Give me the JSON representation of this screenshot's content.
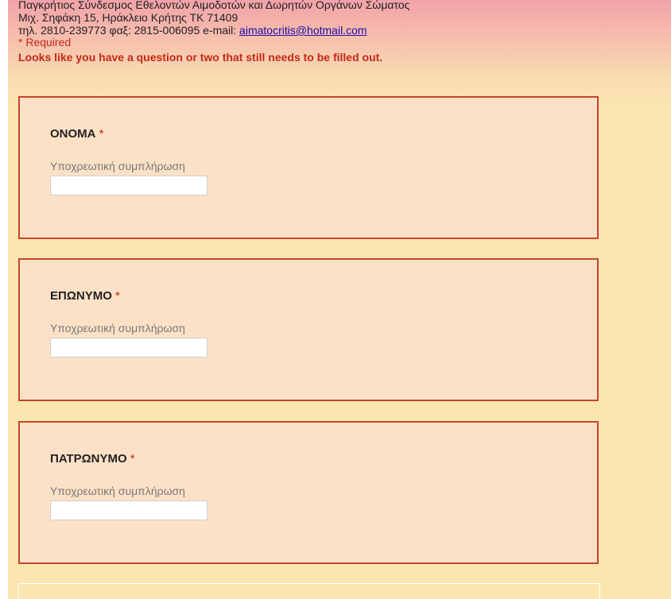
{
  "header": {
    "line1": "Παγκρήτιος Σύνδεσμος Εθελοντών Αιμοδοτών και Δωρητών Οργάνων Σώματος",
    "line2": "Μιχ. Σηφάκη 15, Ηράκλειο Κρήτης ΤΚ 71409",
    "contact_prefix": "τηλ. 2810-239773 φαξ: 2815-006095 e-mail: ",
    "email": "aimatocritis@hotmail.com",
    "required_note": "* Required",
    "error_message": "Looks like you have a question or two that still needs to be filled out."
  },
  "questions": [
    {
      "title": "ΟΝΟΜΑ",
      "required_star": "*",
      "help_text": "Υποχρεωτική συμπλήρωση",
      "value": ""
    },
    {
      "title": "ΕΠΩΝΥΜΟ",
      "required_star": "*",
      "help_text": "Υποχρεωτική συμπλήρωση",
      "value": ""
    },
    {
      "title": "ΠΑΤΡΩΝΥΜΟ",
      "required_star": "*",
      "help_text": "Υποχρεωτική συμπλήρωση",
      "value": ""
    }
  ],
  "colors": {
    "error_red": "#c5271a",
    "card_border": "#c9442e",
    "card_background": "#fde1c6",
    "page_background": "#fbe6b0"
  }
}
